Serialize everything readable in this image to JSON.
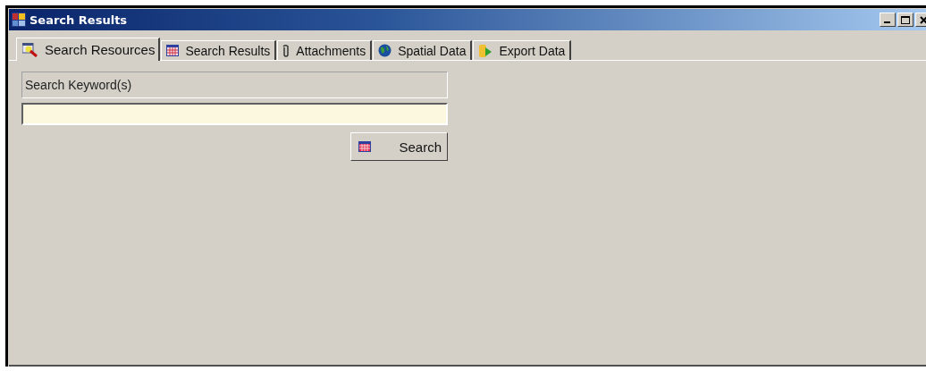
{
  "window": {
    "title": "Search Results"
  },
  "tabs": [
    {
      "label": "Search Resources",
      "selected": true
    },
    {
      "label": "Search Results",
      "selected": false
    },
    {
      "label": "Attachments",
      "selected": false
    },
    {
      "label": "Spatial Data",
      "selected": false
    },
    {
      "label": "Export Data",
      "selected": false
    }
  ],
  "search": {
    "label": "Search Keyword(s)",
    "button": "Search"
  }
}
